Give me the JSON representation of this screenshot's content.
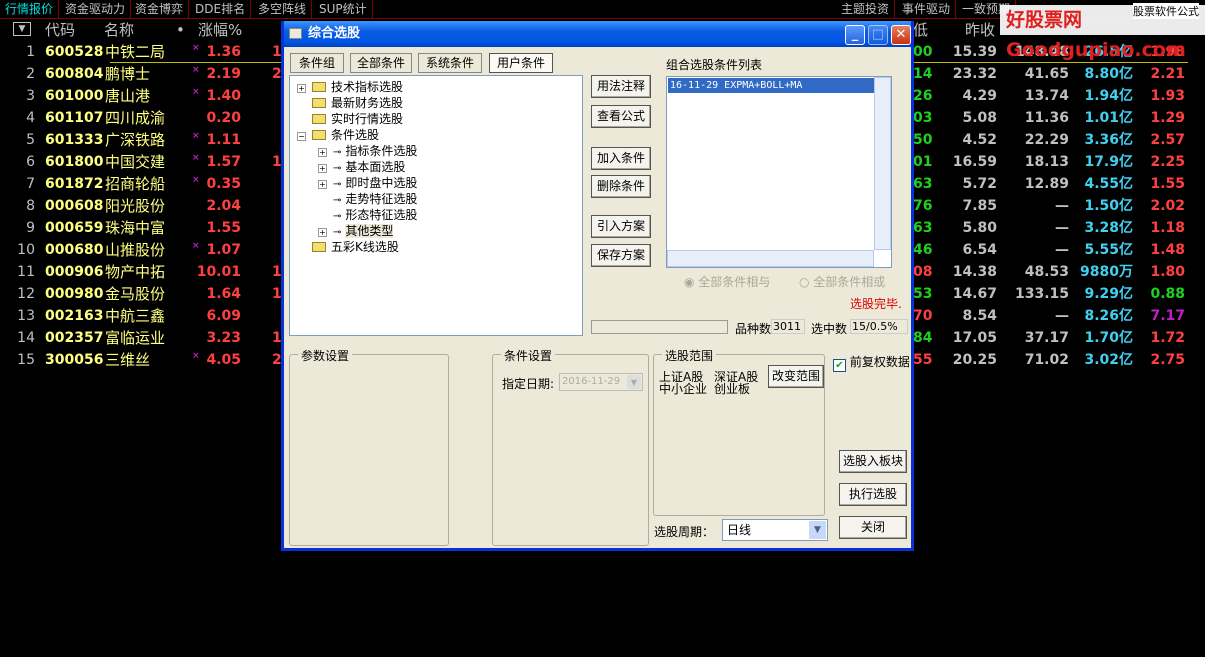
{
  "top_tabs_left": [
    "行情报价",
    "资金驱动力",
    "资金博弈",
    "DDE排名",
    "多空阵线",
    "SUP统计"
  ],
  "top_tabs_right": [
    "主题投资",
    "事件驱动",
    "一致预期"
  ],
  "watermark": "好股票网Goodgupiao.com",
  "watermark2": "股票软件公式",
  "headers": {
    "code": "代码",
    "name": "名称",
    "dot": "•",
    "chg": "涨幅%",
    "low": "低",
    "prev": "昨收"
  },
  "rows": [
    {
      "i": "1",
      "code": "600528",
      "name": "中铁二局",
      "mark": "×",
      "chg": "1.36",
      "p1": "1",
      "p2": "00",
      "p2c": "#20d020",
      "prev": "15.39",
      "pe": "148.48",
      "amt": "26.5亿",
      "vr": "1.98",
      "vrc": "#ff4040"
    },
    {
      "i": "2",
      "code": "600804",
      "name": "鹏博士",
      "mark": "×",
      "chg": "2.19",
      "p1": "2",
      "p2": "14",
      "p2c": "#20d020",
      "prev": "23.32",
      "pe": "41.65",
      "amt": "8.80亿",
      "vr": "2.21",
      "vrc": "#ff4040"
    },
    {
      "i": "3",
      "code": "601000",
      "name": "唐山港",
      "mark": "×",
      "chg": "1.40",
      "p1": "",
      "p2": "26",
      "p2c": "#20d020",
      "prev": "4.29",
      "pe": "13.74",
      "amt": "1.94亿",
      "vr": "1.93",
      "vrc": "#ff4040"
    },
    {
      "i": "4",
      "code": "601107",
      "name": "四川成渝",
      "mark": "",
      "chg": "0.20",
      "p1": "",
      "p2": "03",
      "p2c": "#20d020",
      "prev": "5.08",
      "pe": "11.36",
      "amt": "1.01亿",
      "vr": "1.29",
      "vrc": "#ff4040"
    },
    {
      "i": "5",
      "code": "601333",
      "name": "广深铁路",
      "mark": "×",
      "chg": "1.11",
      "p1": "",
      "p2": "50",
      "p2c": "#20d020",
      "prev": "4.52",
      "pe": "22.29",
      "amt": "3.36亿",
      "vr": "2.57",
      "vrc": "#ff4040"
    },
    {
      "i": "6",
      "code": "601800",
      "name": "中国交建",
      "mark": "×",
      "chg": "1.57",
      "p1": "1",
      "p2": "01",
      "p2c": "#20d020",
      "prev": "16.59",
      "pe": "18.13",
      "amt": "17.9亿",
      "vr": "2.25",
      "vrc": "#ff4040"
    },
    {
      "i": "7",
      "code": "601872",
      "name": "招商轮船",
      "mark": "×",
      "chg": "0.35",
      "p1": "",
      "p2": "63",
      "p2c": "#20d020",
      "prev": "5.72",
      "pe": "12.89",
      "amt": "4.55亿",
      "vr": "1.55",
      "vrc": "#ff4040"
    },
    {
      "i": "8",
      "code": "000608",
      "name": "阳光股份",
      "mark": "",
      "chg": "2.04",
      "p1": "",
      "p2": "76",
      "p2c": "#20d020",
      "prev": "7.85",
      "pe": "—",
      "amt": "1.50亿",
      "vr": "2.02",
      "vrc": "#ff4040"
    },
    {
      "i": "9",
      "code": "000659",
      "name": "珠海中富",
      "mark": "",
      "chg": "1.55",
      "p1": "",
      "p2": "63",
      "p2c": "#20d020",
      "prev": "5.80",
      "pe": "—",
      "amt": "3.28亿",
      "vr": "1.18",
      "vrc": "#ff4040"
    },
    {
      "i": "10",
      "code": "000680",
      "name": "山推股份",
      "mark": "×",
      "chg": "1.07",
      "p1": "",
      "p2": "46",
      "p2c": "#20d020",
      "prev": "6.54",
      "pe": "—",
      "amt": "5.55亿",
      "vr": "1.48",
      "vrc": "#ff4040"
    },
    {
      "i": "11",
      "code": "000906",
      "name": "物产中拓",
      "mark": "",
      "chg": "10.01",
      "p1": "1",
      "p2": "08",
      "p2c": "#ff4040",
      "prev": "14.38",
      "pe": "48.53",
      "amt": "9880万",
      "vr": "1.80",
      "vrc": "#ff4040"
    },
    {
      "i": "12",
      "code": "000980",
      "name": "金马股份",
      "mark": "",
      "chg": "1.64",
      "p1": "1",
      "p2": "53",
      "p2c": "#20d020",
      "prev": "14.67",
      "pe": "133.15",
      "amt": "9.29亿",
      "vr": "0.88",
      "vrc": "#20d020"
    },
    {
      "i": "13",
      "code": "002163",
      "name": "中航三鑫",
      "mark": "",
      "chg": "6.09",
      "p1": "",
      "p2": "70",
      "p2c": "#ff4040",
      "prev": "8.54",
      "pe": "—",
      "amt": "8.26亿",
      "vr": "7.17",
      "vrc": "#c020c0"
    },
    {
      "i": "14",
      "code": "002357",
      "name": "富临运业",
      "mark": "",
      "chg": "3.23",
      "p1": "1",
      "p2": "84",
      "p2c": "#20d020",
      "prev": "17.05",
      "pe": "37.17",
      "amt": "1.70亿",
      "vr": "1.72",
      "vrc": "#ff4040"
    },
    {
      "i": "15",
      "code": "300056",
      "name": "三维丝",
      "mark": "×",
      "chg": "4.05",
      "p1": "2",
      "p2": "55",
      "p2c": "#ff4040",
      "prev": "20.25",
      "pe": "71.02",
      "amt": "3.02亿",
      "vr": "2.75",
      "vrc": "#ff4040"
    }
  ],
  "dialog": {
    "title": "综合选股",
    "minimize": "_",
    "maximize": "□",
    "close": "✕",
    "tabs": [
      "条件组",
      "全部条件",
      "系统条件",
      "用户条件"
    ],
    "tree": [
      {
        "label": "技术指标选股",
        "pm": "+"
      },
      {
        "label": "最新财务选股",
        "pm": ""
      },
      {
        "label": "实时行情选股",
        "pm": ""
      },
      {
        "label": "条件选股",
        "pm": "−"
      },
      {
        "label": "指标条件选股",
        "pm": "+"
      },
      {
        "label": "基本面选股",
        "pm": "+"
      },
      {
        "label": "即时盘中选股",
        "pm": "+"
      },
      {
        "label": "走势特征选股",
        "pm": ""
      },
      {
        "label": "形态特征选股",
        "pm": ""
      },
      {
        "label": "其他类型",
        "pm": "+"
      },
      {
        "label": "五彩K线选股",
        "pm": ""
      }
    ],
    "buttons": [
      "用法注释",
      "查看公式",
      "加入条件",
      "删除条件",
      "引入方案",
      "保存方案"
    ],
    "list_title": "组合选股条件列表",
    "list_items": [
      "16-11-29 EXPMA+BOLL+MA"
    ],
    "radio_and": "全部条件相与",
    "radio_or": "全部条件相或",
    "status": "选股完毕.",
    "count_label": "品种数",
    "count_value": "3011",
    "selected_label": "选中数",
    "selected_value": "15/0.5%",
    "param_group": "参数设置",
    "cond_group": "条件设置",
    "date_label": "指定日期:",
    "date_value": "2016-11-29",
    "range_group": "选股范围",
    "range_items": [
      "上证A股",
      "深证A股",
      "中小企业",
      "创业板"
    ],
    "change_range": "改变范围",
    "fq_label": "前复权数据",
    "fq_checked": true,
    "to_block": "选股入板块",
    "execute": "执行选股",
    "close_btn": "关闭",
    "period_label": "选股周期：",
    "period_value": "日线"
  }
}
